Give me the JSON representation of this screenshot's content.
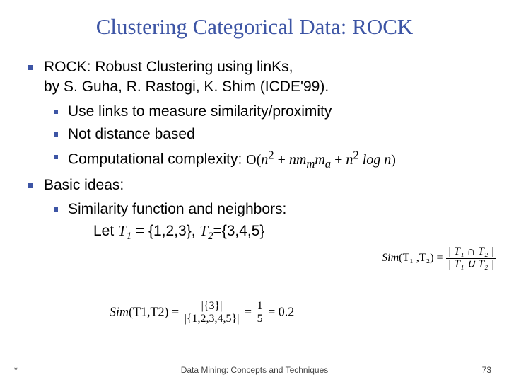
{
  "title": "Clustering Categorical Data: ROCK",
  "items": {
    "rock_intro_line1": "ROCK: Robust Clustering using linKs,",
    "rock_intro_line2": "by S. Guha, R. Rastogi, K. Shim (ICDE'99).",
    "sub1": "Use links to measure similarity/proximity",
    "sub2": "Not distance based",
    "sub3": "Computational complexity:",
    "basic_ideas": "Basic ideas:",
    "sim_func": "Similarity function and neighbors:",
    "let_prefix": "Let ",
    "let_t1": "T",
    "let_eq1": " = {1,2,3}, ",
    "let_t2": "T",
    "let_eq2": "={3,4,5}"
  },
  "complexity": {
    "O": "O",
    "open": "(",
    "n2a": "n",
    "plus1": " + ",
    "nm": "nm",
    "m_sub": "m",
    "m_a": "m",
    "plus2": " + ",
    "n2b": "n",
    "logn": " log n",
    "close": ")"
  },
  "sim_block": {
    "lhs": "Sim",
    "args": "(T₁ ,T₂)",
    "eq": " = ",
    "num": "| T₁ ∩ T₂ |",
    "den": "| T₁ ∪ T₂ |"
  },
  "bottom_eq": {
    "lhs": "Sim",
    "args": "(T1,T2)",
    "eq1": " = ",
    "num1": "|{3}|",
    "den1": "|{1,2,3,4,5}|",
    "eq2": " = ",
    "num2": "1",
    "den2": "5",
    "eq3": " = 0.2"
  },
  "footer": {
    "left": "*",
    "center": "Data Mining: Concepts and Techniques",
    "right": "73"
  }
}
